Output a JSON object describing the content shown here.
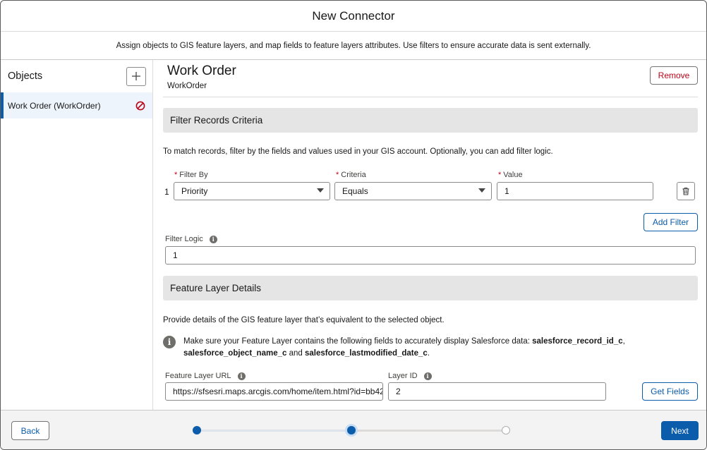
{
  "header": {
    "title": "New Connector"
  },
  "subheader": {
    "text": "Assign objects to GIS feature layers, and map fields to feature layers attributes. Use filters to ensure accurate data is sent externally."
  },
  "sidebar": {
    "title": "Objects",
    "add_icon": "plus-icon",
    "items": [
      {
        "label": "Work Order (WorkOrder)",
        "status_icon": "block-icon",
        "status_color": "#ba0517"
      }
    ]
  },
  "object": {
    "title": "Work Order",
    "api_name": "WorkOrder",
    "remove_label": "Remove"
  },
  "filter_section": {
    "title": "Filter Records Criteria",
    "description": "To match records, filter by the fields and values used in your GIS account. Optionally, you can add filter logic.",
    "labels": {
      "filter_by": "Filter By",
      "criteria": "Criteria",
      "value": "Value"
    },
    "rows": [
      {
        "num": "1",
        "filter_by": "Priority",
        "criteria": "Equals",
        "value": "1"
      }
    ],
    "add_filter_label": "Add Filter",
    "filter_logic_label": "Filter Logic",
    "filter_logic_value": "1"
  },
  "feature_section": {
    "title": "Feature Layer Details",
    "description": "Provide details of the GIS feature layer that’s equivalent to the selected object.",
    "notice": {
      "prefix": "Make sure your Feature Layer contains the following fields to accurately display Salesforce data: ",
      "field1": "salesforce_record_id_c",
      "sep1": ",",
      "field2": "salesforce_object_name_c",
      "sep2": " and ",
      "field3": "salesforce_lastmodified_date_c",
      "suffix": "."
    },
    "url_label": "Feature Layer URL",
    "url_value": "https://sfsesri.maps.arcgis.com/home/item.html?id=bb42",
    "layer_id_label": "Layer ID",
    "layer_id_value": "2",
    "get_fields_label": "Get Fields"
  },
  "footer": {
    "back_label": "Back",
    "next_label": "Next",
    "steps": [
      "done",
      "current",
      "todo"
    ],
    "accent": "#0b5cab"
  }
}
